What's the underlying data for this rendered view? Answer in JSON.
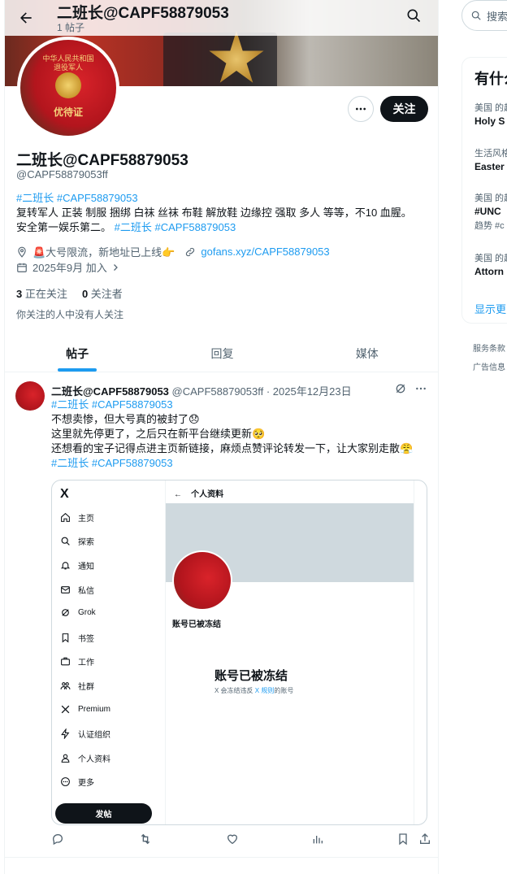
{
  "header": {
    "title": "二班长@CAPF58879053",
    "subtitle": "1 帖子"
  },
  "profile": {
    "avatar_text_line1": "中华人民共和国",
    "avatar_text_line2": "退役军人",
    "avatar_text_line3": "优待证",
    "follow_label": "关注",
    "display_name": "二班长@CAPF58879053",
    "handle": "@CAPF58879053ff",
    "bio_tags_1": "#二班长 #CAPF58879053",
    "bio_line_1": "复转军人 正装 制服 捆绑 白袜 丝袜 布鞋 解放鞋 边缘控 强取 多人 等等，不10 血腥。",
    "bio_line_2": "安全第一娱乐第二。",
    "bio_tags_2": "#二班长 #CAPF58879053",
    "location": "🚨大号限流，新地址已上线👉",
    "website": "gofans.xyz/CAPF58879053",
    "joined": "2025年9月 加入",
    "following_count": "3",
    "following_label": "正在关注",
    "followers_count": "0",
    "followers_label": "关注者",
    "no_mutuals": "你关注的人中没有人关注"
  },
  "tabs": [
    {
      "label": "帖子",
      "active": true
    },
    {
      "label": "回复",
      "active": false
    },
    {
      "label": "媒体",
      "active": false
    }
  ],
  "post": {
    "name": "二班长@CAPF58879053",
    "handle_date": "@CAPF58879053ff · 2025年12月23日",
    "tags_top": "#二班长 #CAPF58879053",
    "line_1": "不想卖惨，但大号真的被封了😞",
    "line_2": "这里就先停更了，之后只在新平台继续更新🥺",
    "line_3": "还想看的宝子记得点进主页新链接，麻烦点赞评论转发一下，让大家别走散😤",
    "tags_bottom": "#二班长 #CAPF58879053",
    "media": {
      "logo": "X",
      "nav": [
        "主页",
        "探索",
        "通知",
        "私信",
        "Grok",
        "书签",
        "工作",
        "社群",
        "Premium",
        "认证组织",
        "个人资料",
        "更多"
      ],
      "post_button": "发帖",
      "header_title": "个人资料",
      "frozen_small": "账号已被冻结",
      "frozen_big": "账号已被冻结",
      "frozen_sub_a": "X 会冻结违反 ",
      "frozen_sub_link": "X 规则",
      "frozen_sub_b": "的账号"
    }
  },
  "sidebar": {
    "search_placeholder": "搜索",
    "trends_title": "有什么",
    "trends": [
      {
        "context": "美国 的趋势",
        "topic": "Holy S",
        "extra": ""
      },
      {
        "context": "生活风格 · 趋势",
        "topic": "Easter",
        "extra": ""
      },
      {
        "context": "美国 的趋势",
        "topic": "#UNC",
        "extra": "趋势 #c"
      },
      {
        "context": "美国 的趋势",
        "topic": "Attorn",
        "extra": ""
      }
    ],
    "show_more": "显示更多",
    "footer_1": "服务条款",
    "footer_2": "广告信息"
  },
  "colors": {
    "accent": "#1d9bf0",
    "text_primary": "#0f1419",
    "text_secondary": "#536471",
    "border": "#eff3f4"
  }
}
